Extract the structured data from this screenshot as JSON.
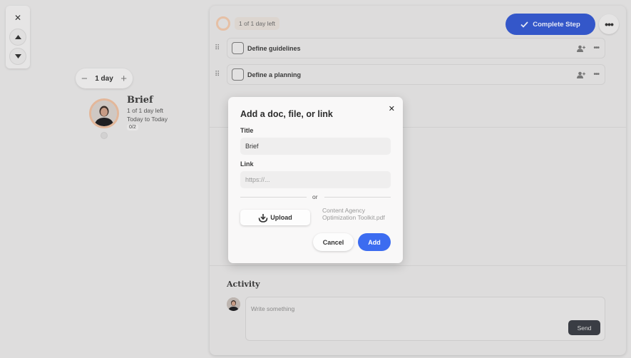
{
  "nav": {
    "close_icon": "close-icon",
    "up_icon": "caret-up-icon",
    "down_icon": "caret-down-icon"
  },
  "day_counter": {
    "minus": "−",
    "value": "1 day",
    "plus": "+"
  },
  "node": {
    "title": "Brief",
    "days_left": "1 of 1 day left",
    "range": "Today to Today",
    "badge": "0/2"
  },
  "header": {
    "days_left": "1 of 1 day left",
    "complete_label": "Complete Step",
    "more": "•••"
  },
  "tasks": [
    {
      "label": "Define guidelines"
    },
    {
      "label": "Define a planning"
    }
  ],
  "activity": {
    "title": "Activity",
    "placeholder": "Write something",
    "send_label": "Send"
  },
  "modal": {
    "title": "Add a doc, file, or link",
    "close": "✕",
    "title_label": "Title",
    "title_value": "Brief",
    "link_label": "Link",
    "link_placeholder": "https://...",
    "or_text": "or",
    "upload_label": "Upload",
    "file_name": "Content Agency Optimization Toolkit.pdf",
    "cancel_label": "Cancel",
    "add_label": "Add"
  },
  "colors": {
    "primary": "#3457c9",
    "add_button": "#3c6cf0",
    "accent_ring": "#e6c0a5",
    "send_button": "#3a3d44"
  }
}
